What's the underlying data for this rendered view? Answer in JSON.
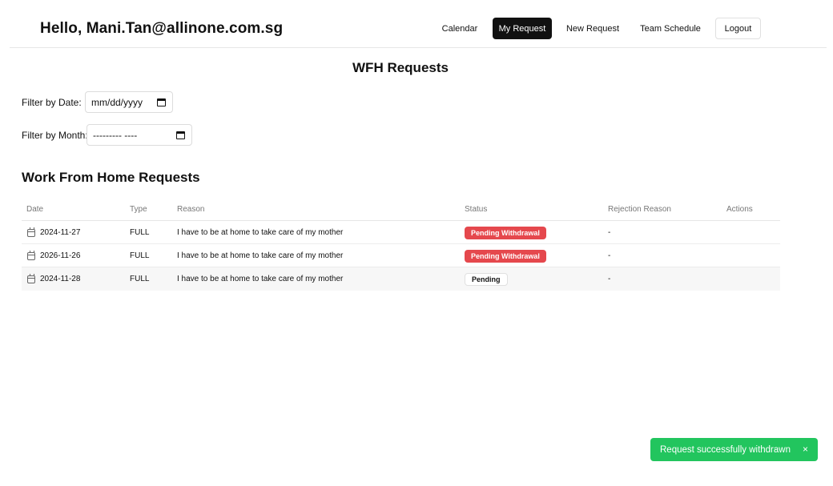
{
  "header": {
    "greeting": "Hello, Mani.Tan@allinone.com.sg",
    "nav": {
      "calendar": "Calendar",
      "my_request": "My Request",
      "new_request": "New Request",
      "team_schedule": "Team Schedule",
      "logout": "Logout"
    },
    "active_nav": "My Request"
  },
  "page_title": "WFH Requests",
  "filters": {
    "date_label": "Filter by Date:",
    "date_placeholder": "mm/dd/yyyy",
    "month_label": "Filter by Month:",
    "month_placeholder": "--------- ----"
  },
  "section_title": "Work From Home Requests",
  "table": {
    "columns": {
      "date": "Date",
      "type": "Type",
      "reason": "Reason",
      "status": "Status",
      "rejection_reason": "Rejection Reason",
      "actions": "Actions"
    },
    "rows": [
      {
        "date": "2024-11-27",
        "type": "FULL",
        "reason": "I have to be at home to take care of my mother",
        "status": "Pending Withdrawal",
        "rejection_reason": "-"
      },
      {
        "date": "2026-11-26",
        "type": "FULL",
        "reason": "I have to be at home to take care of my mother",
        "status": "Pending Withdrawal",
        "rejection_reason": "-"
      },
      {
        "date": "2024-11-28",
        "type": "FULL",
        "reason": "I have to be at home to take care of my mother",
        "status": "Pending",
        "rejection_reason": "-"
      }
    ]
  },
  "toast": {
    "message": "Request successfully withdrawn",
    "close": "×",
    "color": "#22c55e"
  },
  "colors": {
    "active_nav": "#111111",
    "status_withdrawal": "#e5484d"
  },
  "icons": {
    "row_date_icon": "calendar-icon",
    "filter_icon": "calendar-icon",
    "toast_close_icon": "close-icon"
  }
}
